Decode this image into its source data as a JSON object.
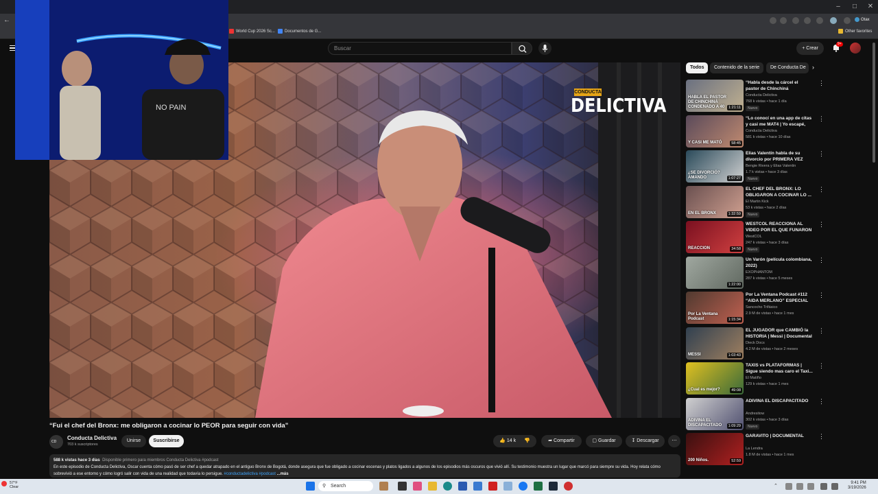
{
  "browser": {
    "bookmarks": [
      "World Cup 2026 Sc...",
      "Documentos de G...",
      "Other favorites"
    ],
    "profile_label": "Otax"
  },
  "youtube": {
    "search_placeholder": "Buscar",
    "create_label": "Crear",
    "notif_count": "9+"
  },
  "video": {
    "brand_sub": "CONDUCTA",
    "brand_main": "DELICTIVA",
    "title": "“Fui el chef del Bronx: me obligaron a cocinar lo PEOR para seguir con vida”",
    "channel": "Conducta Delictiva",
    "subscribers": "703 k suscriptores",
    "join_label": "Unirse",
    "subscribe_label": "Suscribirse",
    "likes": "14 k",
    "share_label": "Compartir",
    "save_label": "Guardar",
    "download_label": "Descargar",
    "desc_meta": "588 k vistas  hace 3 días",
    "desc_meta2": "Disponible primero para miembros  Conducta Delictiva #podcast",
    "desc_text": "En este episodio de Conducta Delictiva, Oscar cuenta cómo pasó de ser chef a quedar atrapado en el antiguo Bronx de Bogotá, donde asegura que fue obligado a cocinar escenas y platos ligados a algunos de los episodios más oscuros que vivió allí. Su testimonio muestra un lugar que marcó para siempre su vida. Hoy relata cómo sobrevivió a ese entorno y cómo logró salir con vida de una realidad que todavía lo persigue.",
    "desc_tags": "#conductadelictiva #podcast",
    "desc_more": "...más"
  },
  "sidebar": {
    "chips": [
      "Todos",
      "Contenido de la serie",
      "De Conducta De"
    ],
    "recs": [
      {
        "title": "“Habla desde la cárcel el pastor de Chinchiná condenado a 40 ...",
        "channel": "Conducta Delictiva",
        "meta": "768 k vistas • hace 1 día",
        "badge": "Nuevo",
        "dur": "1:21:11",
        "c1": "#6a7080",
        "c2": "#c0b090",
        "cap": "HABLA EL PASTOR DE CHINCHINÁ CONDENADO A 40"
      },
      {
        "title": "“Lo conocí en una app de citas y casi me MAT4 | Yo escapé, per...",
        "channel": "Conducta Delictiva",
        "meta": "581 k vistas • hace 10 días",
        "badge": "",
        "dur": "58:45",
        "c1": "#5a4a5a",
        "c2": "#c08a70",
        "cap": "Y CASI ME MATÓ"
      },
      {
        "title": "Elias Valentín habla de su divorcio por PRIMERA VEZ",
        "channel": "Bengie Rivera y Elias Valentin",
        "meta": "1.7 k vistas • hace 3 días",
        "badge": "Nuevo",
        "dur": "1:07:27",
        "c1": "#2a4a5a",
        "c2": "#d0d0d0",
        "cap": "¿SE DIVORCIÓ? AMANDO"
      },
      {
        "title": "EL CHEF DEL BRONX: LO OBLIGARON A COCINAR LO ...",
        "channel": "El Martin Kick",
        "meta": "53 k vistas • hace 2 días",
        "badge": "Nuevo",
        "dur": "1:32:59",
        "c1": "#6a5050",
        "c2": "#d0a090",
        "cap": "EN EL BRONX"
      },
      {
        "title": "WESTCOL REACCIONA AL VIDEO POR EL QUE FUNARON ...",
        "channel": "WestCOL",
        "meta": "247 k vistas • hace 3 días",
        "badge": "Nuevo",
        "dur": "34:58",
        "c1": "#7a1020",
        "c2": "#d04040",
        "cap": "REACCION"
      },
      {
        "title": "Un Varón (película colombiana, 2022)",
        "channel": "EXOPHANTOM",
        "meta": "287 k vistas • hace 5 meses",
        "badge": "",
        "dur": "1:22:00",
        "c1": "#a0a8a0",
        "c2": "#606860",
        "cap": ""
      },
      {
        "title": "Por La Ventana Podcast #112 “AIDA MERLANO” ESPECIAL ...",
        "channel": "Sancocho Trifásico",
        "meta": "2.9 M de vistas • hace 1 mes",
        "badge": "",
        "dur": "1:15:34",
        "c1": "#503a30",
        "c2": "#c06050",
        "cap": "Por La Ventana Podcast"
      },
      {
        "title": "EL JUGADOR que CAMBIÓ la HISTORIA | Messi | Documental",
        "channel": "Dieck Docs",
        "meta": "4.2 M de vistas • hace 2 meses",
        "badge": "",
        "dur": "1:03:43",
        "c1": "#304050",
        "c2": "#a08060",
        "cap": "MESSI"
      },
      {
        "title": "TAXIS vs PLATAFORMAS | Sigue siendo mas caro el Taxi...",
        "channel": "El Matiño",
        "meta": "129 k vistas • hace 1 mes",
        "badge": "",
        "dur": "49:08",
        "c1": "#e0c020",
        "c2": "#3a6a3a",
        "cap": "¿Cual es mejor?"
      },
      {
        "title": "ADIVINA EL DISCAPACITADO",
        "channel": "Andresitow",
        "meta": "302 k vistas • hace 3 días",
        "badge": "Nuevo",
        "dur": "1:09:29",
        "c1": "#d0d0d0",
        "c2": "#505070",
        "cap": "ADIVINA EL DISCAPACITADO"
      },
      {
        "title": "GARAVITO | DOCUMENTAL",
        "channel": "La Lendra",
        "meta": "1.8 M de vistas • hace 1 mes",
        "badge": "",
        "dur": "52:59",
        "c1": "#3a1010",
        "c2": "#b02020",
        "cap": "200 Niños."
      }
    ]
  },
  "taskbar": {
    "search_label": "Search",
    "weather_temp": "57°F",
    "weather_cond": "Clear",
    "time": "9:41 PM",
    "date": "3/19/2026"
  }
}
